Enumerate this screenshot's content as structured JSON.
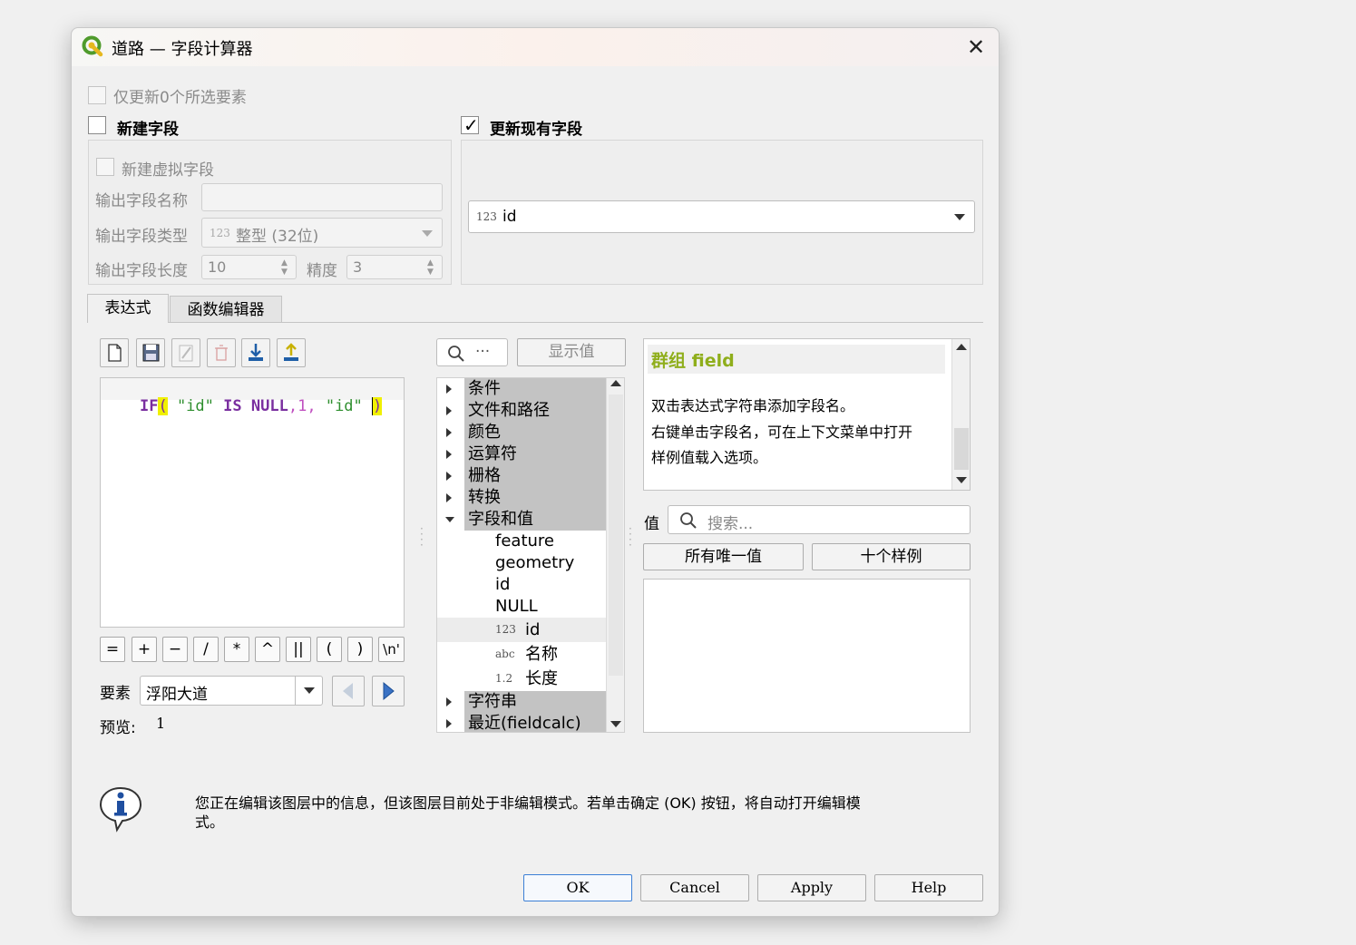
{
  "window": {
    "title": "道路 — 字段计算器"
  },
  "only_selected": {
    "label": "仅更新0个所选要素",
    "checked": false,
    "enabled": false
  },
  "new_field": {
    "label": "新建字段",
    "checked": false,
    "virtual_label": "新建虚拟字段",
    "name_label": "输出字段名称",
    "name_value": "",
    "type_label": "输出字段类型",
    "type_icon": "123",
    "type_value": "整型 (32位)",
    "length_label": "输出字段长度",
    "length_value": "10",
    "precision_label": "精度",
    "precision_value": "3"
  },
  "update_field": {
    "label": "更新现有字段",
    "checked": true,
    "field_icon": "123",
    "field_value": "id"
  },
  "tabs": [
    {
      "label": "表达式",
      "active": true
    },
    {
      "label": "函数编辑器",
      "active": false
    }
  ],
  "toolbar_icons": [
    "new-file-icon",
    "save-icon",
    "edit-icon",
    "delete-icon",
    "import-icon",
    "export-icon"
  ],
  "expression": {
    "parts": [
      "IF",
      "(",
      " ",
      "\"id\"",
      " ",
      "IS",
      " ",
      "NULL",
      ",",
      "1",
      ",",
      " ",
      "\"id\"",
      " ",
      ")"
    ]
  },
  "operators": [
    "=",
    "+",
    "−",
    "/",
    "*",
    "^",
    "||",
    "(",
    ")",
    "\\n'"
  ],
  "feature": {
    "label": "要素",
    "value": "浮阳大道"
  },
  "preview": {
    "label": "预览:",
    "value": "1"
  },
  "search": {
    "placeholder": "···",
    "show_values_label": "显示值"
  },
  "tree": {
    "categories_top": [
      "条件",
      "文件和路径",
      "颜色",
      "运算符",
      "栅格",
      "转换"
    ],
    "expanded": "字段和值",
    "children": [
      "feature",
      "geometry",
      "id",
      "NULL"
    ],
    "fields": [
      {
        "icon": "123",
        "name": "id"
      },
      {
        "icon": "abc",
        "name": "名称"
      },
      {
        "icon": "1.2",
        "name": "长度"
      }
    ],
    "categories_bottom": [
      "字符串",
      "最近(fieldcalc)"
    ]
  },
  "help": {
    "title": "群组 field",
    "lines": [
      "双击表达式字符串添加字段名。",
      "右键单击字段名，可在上下文菜单中打开",
      "样例值载入选项。"
    ]
  },
  "values": {
    "label": "值",
    "search_placeholder": "搜索...",
    "all_unique_label": "所有唯一值",
    "ten_samples_label": "十个样例"
  },
  "info": {
    "message_line1": "您正在编辑该图层中的信息，但该图层目前处于非编辑模式。若单击确定 (OK) 按钮，将自动打开编辑模",
    "message_line2": "式。"
  },
  "buttons": {
    "ok": "OK",
    "cancel": "Cancel",
    "apply": "Apply",
    "help": "Help"
  },
  "colors": {
    "keyword": "#7a2fa0",
    "string": "#2f8f2f",
    "number": "#c050c0",
    "bracket_highlight": "#f0f000",
    "help_title": "#8fae1b"
  }
}
